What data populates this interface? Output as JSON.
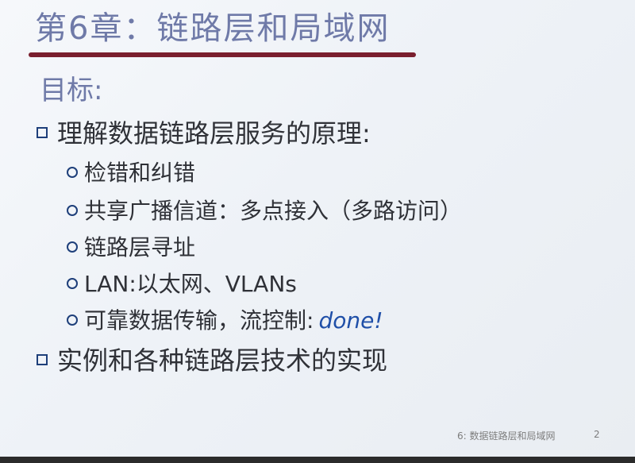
{
  "slide": {
    "title": "第6章：链路层和局域网",
    "goal_heading": "目标:",
    "bullets": [
      "理解数据链路层服务的原理:",
      "实例和各种链路层技术的实现"
    ],
    "sub_bullets": [
      "检错和纠错",
      "共享广播信道：多点接入（多路访问）",
      "链路层寻址",
      "LAN:以太网、VLANs",
      "可靠数据传输，流控制:"
    ],
    "done_text": "done!",
    "footer": "6: 数据链路层和局域网",
    "page_number": "2"
  },
  "colors": {
    "title": "#6f7aa8",
    "rule": "#7a1f2e",
    "bullet_marker": "#1e3f7a",
    "done": "#1f4fa8"
  }
}
